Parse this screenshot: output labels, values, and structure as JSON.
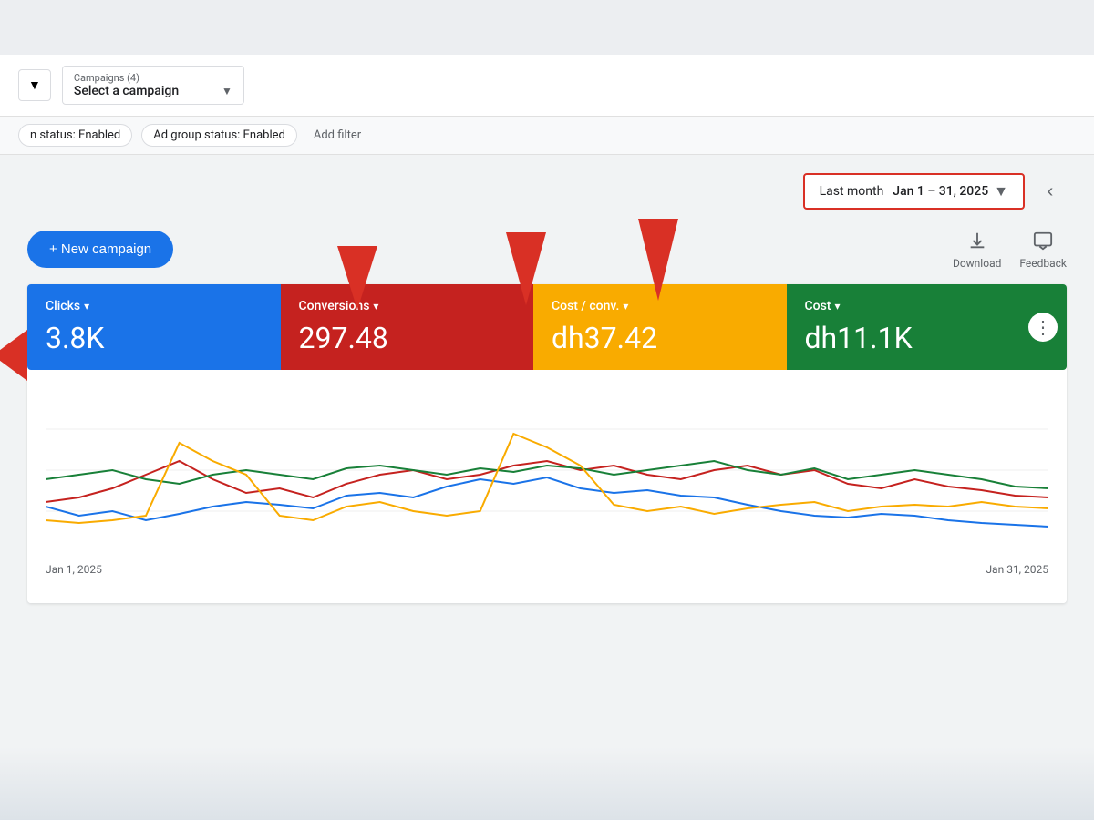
{
  "topBar": {
    "accountSelectLabel": "▼",
    "campaignSelect": {
      "label": "Campaigns (4)",
      "value": "Select a campaign",
      "chevron": "▼"
    }
  },
  "filterBar": {
    "filters": [
      {
        "label": "n status: Enabled"
      },
      {
        "label": "Ad group status: Enabled"
      }
    ],
    "addFilter": "Add filter"
  },
  "dateRange": {
    "label": "Last month",
    "value": "Jan 1 – 31, 2025",
    "chevron": "▼"
  },
  "toolbar": {
    "newCampaign": "+ New campaign",
    "download": "Download",
    "feedback": "Feedback"
  },
  "stats": [
    {
      "id": "clicks",
      "label": "Clicks",
      "value": "3.8K",
      "color": "blue",
      "chevron": "▾"
    },
    {
      "id": "conversions",
      "label": "Conversions",
      "value": "297.48",
      "color": "red",
      "chevron": "▾"
    },
    {
      "id": "cost-conv",
      "label": "Cost / conv.",
      "value": "dh37.42",
      "color": "yellow",
      "chevron": "▾"
    },
    {
      "id": "cost",
      "label": "Cost",
      "value": "dh11.1K",
      "color": "green",
      "chevron": "▾"
    }
  ],
  "chart": {
    "startDate": "Jan 1, 2025",
    "endDate": "Jan 31, 2025"
  },
  "annotations": {
    "arrows": [
      {
        "id": "arrow1",
        "label": ""
      },
      {
        "id": "arrow2",
        "label": ""
      },
      {
        "id": "arrow3",
        "label": ""
      }
    ]
  }
}
